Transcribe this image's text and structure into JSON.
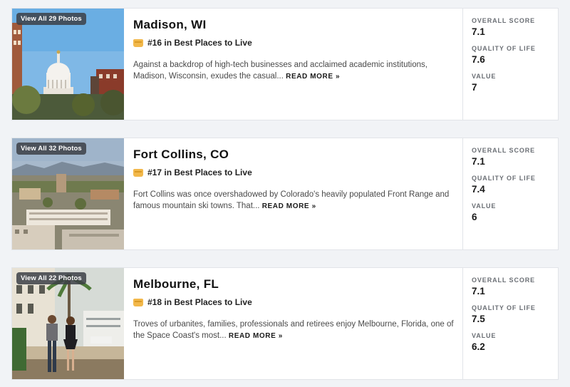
{
  "cities": [
    {
      "photo_badge": "View All 29 Photos",
      "name": "Madison, WI",
      "rank": "#16 in Best Places to Live",
      "description": "Against a backdrop of high-tech businesses and acclaimed academic institutions, Madison, Wisconsin, exudes the casual...",
      "read_more": "READ MORE »",
      "scores": [
        {
          "label": "OVERALL SCORE",
          "value": "7.1"
        },
        {
          "label": "QUALITY OF LIFE",
          "value": "7.6"
        },
        {
          "label": "VALUE",
          "value": "7"
        }
      ]
    },
    {
      "photo_badge": "View All 32 Photos",
      "name": "Fort Collins, CO",
      "rank": "#17 in Best Places to Live",
      "description": "Fort Collins was once overshadowed by Colorado's heavily populated Front Range and famous mountain ski towns. That...",
      "read_more": "READ MORE »",
      "scores": [
        {
          "label": "OVERALL SCORE",
          "value": "7.1"
        },
        {
          "label": "QUALITY OF LIFE",
          "value": "7.4"
        },
        {
          "label": "VALUE",
          "value": "6"
        }
      ]
    },
    {
      "photo_badge": "View All 22 Photos",
      "name": "Melbourne, FL",
      "rank": "#18 in Best Places to Live",
      "description": "Troves of urbanites, families, professionals and retirees enjoy Melbourne, Florida, one of the Space Coast's most...",
      "read_more": "READ MORE »",
      "scores": [
        {
          "label": "OVERALL SCORE",
          "value": "7.1"
        },
        {
          "label": "QUALITY OF LIFE",
          "value": "7.5"
        },
        {
          "label": "VALUE",
          "value": "6.2"
        }
      ]
    }
  ],
  "icons": {
    "rank": "medal-icon"
  },
  "colors": {
    "page_background": "#f1f3f6",
    "card_background": "#ffffff",
    "rank_icon": "#f2b84b",
    "badge_background": "#3c4046"
  }
}
